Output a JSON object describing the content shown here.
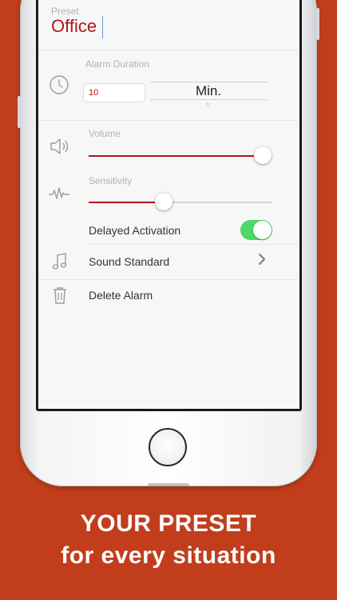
{
  "preset": {
    "label": "Preset",
    "value": "Office"
  },
  "alarm_duration": {
    "label": "Alarm Duration",
    "value": "10",
    "unit": "Min.",
    "unit_next": "h"
  },
  "volume": {
    "label": "Volume",
    "level": 0.95
  },
  "sensitivity": {
    "label": "Sensitivity",
    "level": 0.41
  },
  "delayed_activation": {
    "label": "Delayed Activation",
    "on": true
  },
  "sound": {
    "label": "Sound Standard"
  },
  "delete": {
    "label": "Delete Alarm"
  },
  "promo": {
    "line1": "YOUR PRESET",
    "line2": "for every situation"
  },
  "colors": {
    "background": "#c13d1c",
    "accent": "#b5141a",
    "toggle_on": "#4cd964"
  },
  "icons": [
    "clock-icon",
    "speaker-icon",
    "waveform-icon",
    "music-note-icon",
    "trash-icon",
    "chevron-right-icon"
  ]
}
